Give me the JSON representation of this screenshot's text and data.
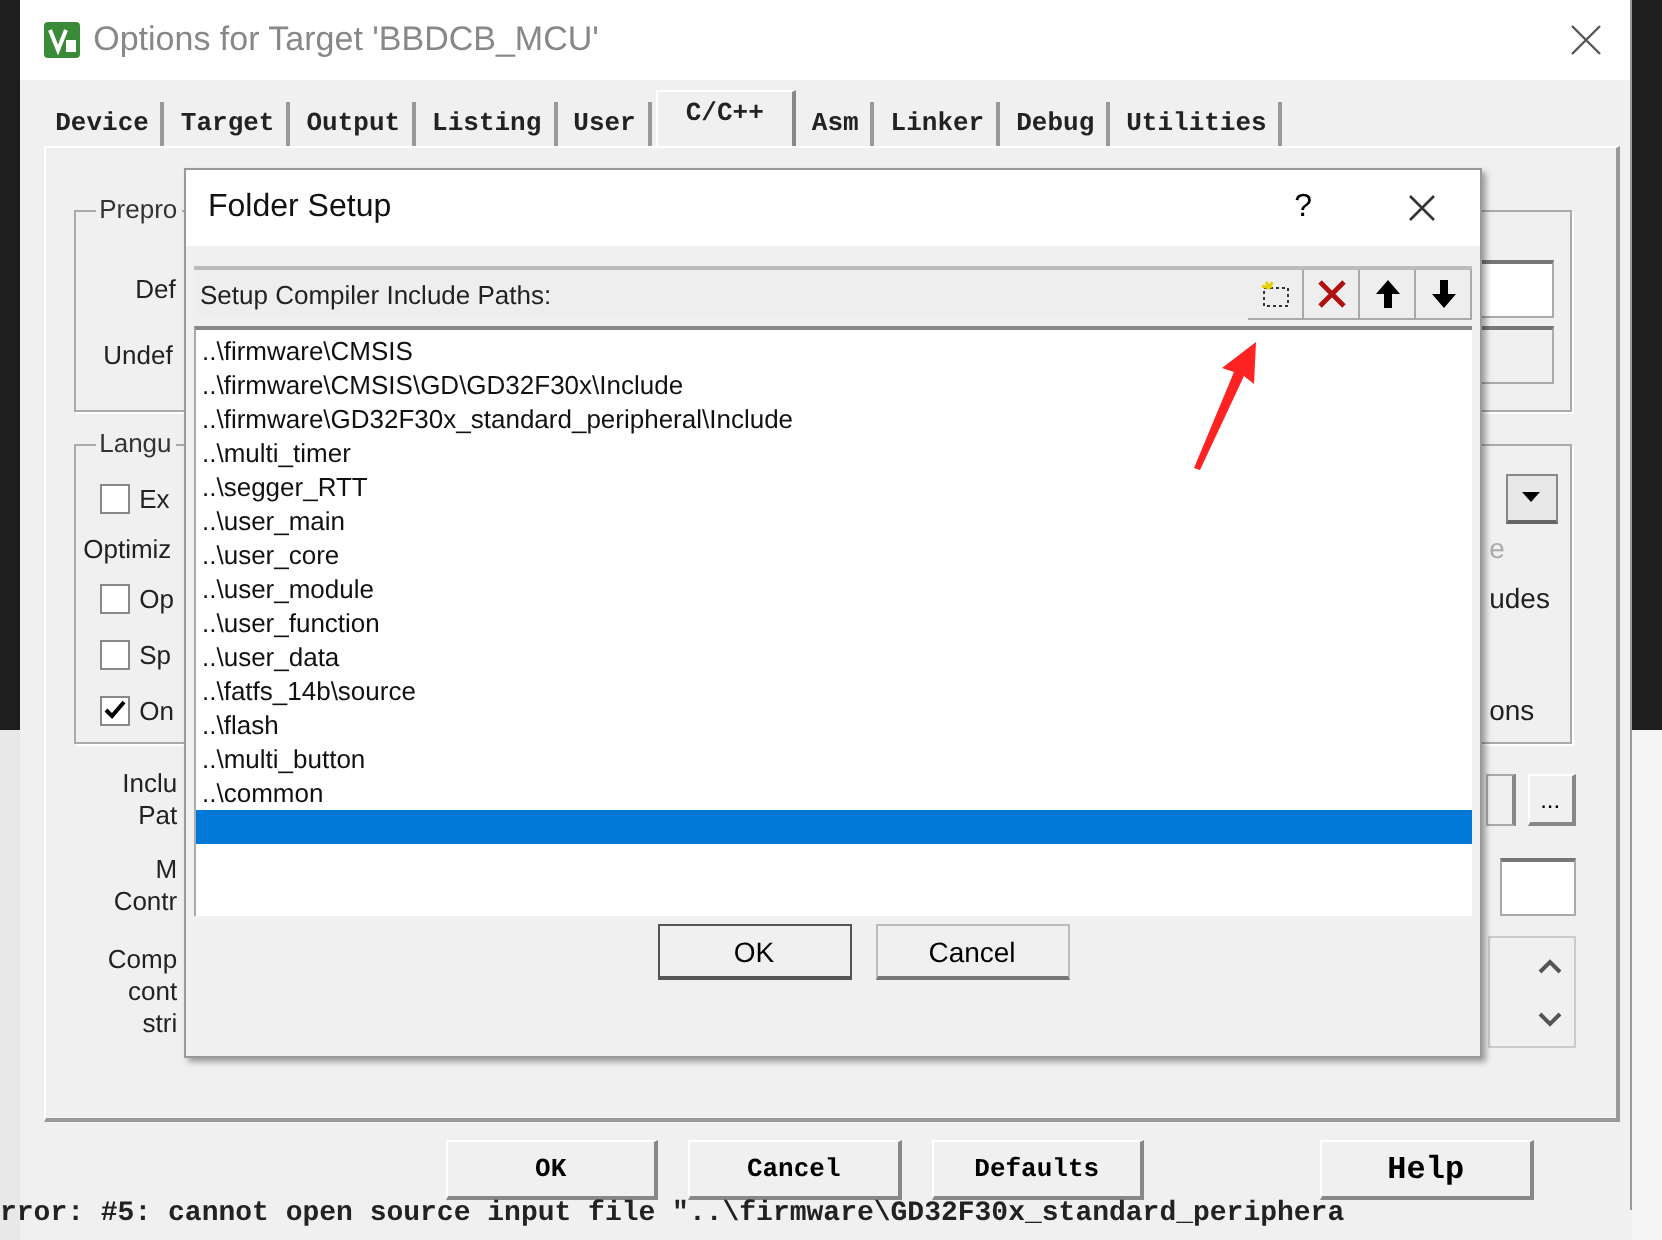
{
  "window": {
    "title": "Options for Target 'BBDCB_MCU'"
  },
  "tabs": [
    {
      "label": "Device",
      "selected": false
    },
    {
      "label": "Target",
      "selected": false
    },
    {
      "label": "Output",
      "selected": false
    },
    {
      "label": "Listing",
      "selected": false
    },
    {
      "label": "User",
      "selected": false
    },
    {
      "label": "C/C++",
      "selected": true
    },
    {
      "label": "Asm",
      "selected": false
    },
    {
      "label": "Linker",
      "selected": false
    },
    {
      "label": "Debug",
      "selected": false
    },
    {
      "label": "Utilities",
      "selected": false
    }
  ],
  "preprocessor": {
    "group_label": "Prepro",
    "define_label": "Def",
    "undefine_label": "Undef"
  },
  "language": {
    "group_label": "Langu",
    "optimization_label": "Optimiz",
    "optimization_right": {
      "text": "e",
      "disabled": true
    },
    "checkboxes": [
      {
        "label": "Ex",
        "checked": false
      },
      {
        "label": "Op",
        "checked": false,
        "right_text": "udes",
        "right_disabled": false
      },
      {
        "label": "Sp",
        "checked": false
      },
      {
        "label": "On",
        "checked": true,
        "right_text": "ons",
        "right_disabled": false
      }
    ]
  },
  "include_paths": {
    "label_lines": [
      "Inclu",
      "Pat"
    ],
    "browse": "..."
  },
  "misc_controls": {
    "label_lines": [
      "M",
      "Contr"
    ]
  },
  "compiler_control": {
    "label_lines": [
      "Comp",
      "cont",
      "stri"
    ]
  },
  "buttons": [
    "OK",
    "Cancel",
    "Defaults",
    "Help"
  ],
  "background_text": "rror:  #5: cannot open source input file  \"..\\firmware\\GD32F30x_standard_periphera",
  "folder_setup": {
    "title": "Folder Setup",
    "help": "?",
    "header": "Setup Compiler Include Paths:",
    "paths": [
      {
        "path": "..\\firmware\\CMSIS",
        "selected": false
      },
      {
        "path": "..\\firmware\\CMSIS\\GD\\GD32F30x\\Include",
        "selected": false
      },
      {
        "path": "..\\firmware\\GD32F30x_standard_peripheral\\Include",
        "selected": false
      },
      {
        "path": "..\\multi_timer",
        "selected": false
      },
      {
        "path": "..\\segger_RTT",
        "selected": false
      },
      {
        "path": "..\\user_main",
        "selected": false
      },
      {
        "path": "..\\user_core",
        "selected": false
      },
      {
        "path": "..\\user_module",
        "selected": false
      },
      {
        "path": "..\\user_function",
        "selected": false
      },
      {
        "path": "..\\user_data",
        "selected": false
      },
      {
        "path": "..\\fatfs_14b\\source",
        "selected": false
      },
      {
        "path": "..\\flash",
        "selected": false
      },
      {
        "path": "..\\multi_button",
        "selected": false
      },
      {
        "path": "..\\common",
        "selected": false
      }
    ],
    "new_entry_selected": true,
    "buttons": [
      "OK",
      "Cancel"
    ]
  }
}
